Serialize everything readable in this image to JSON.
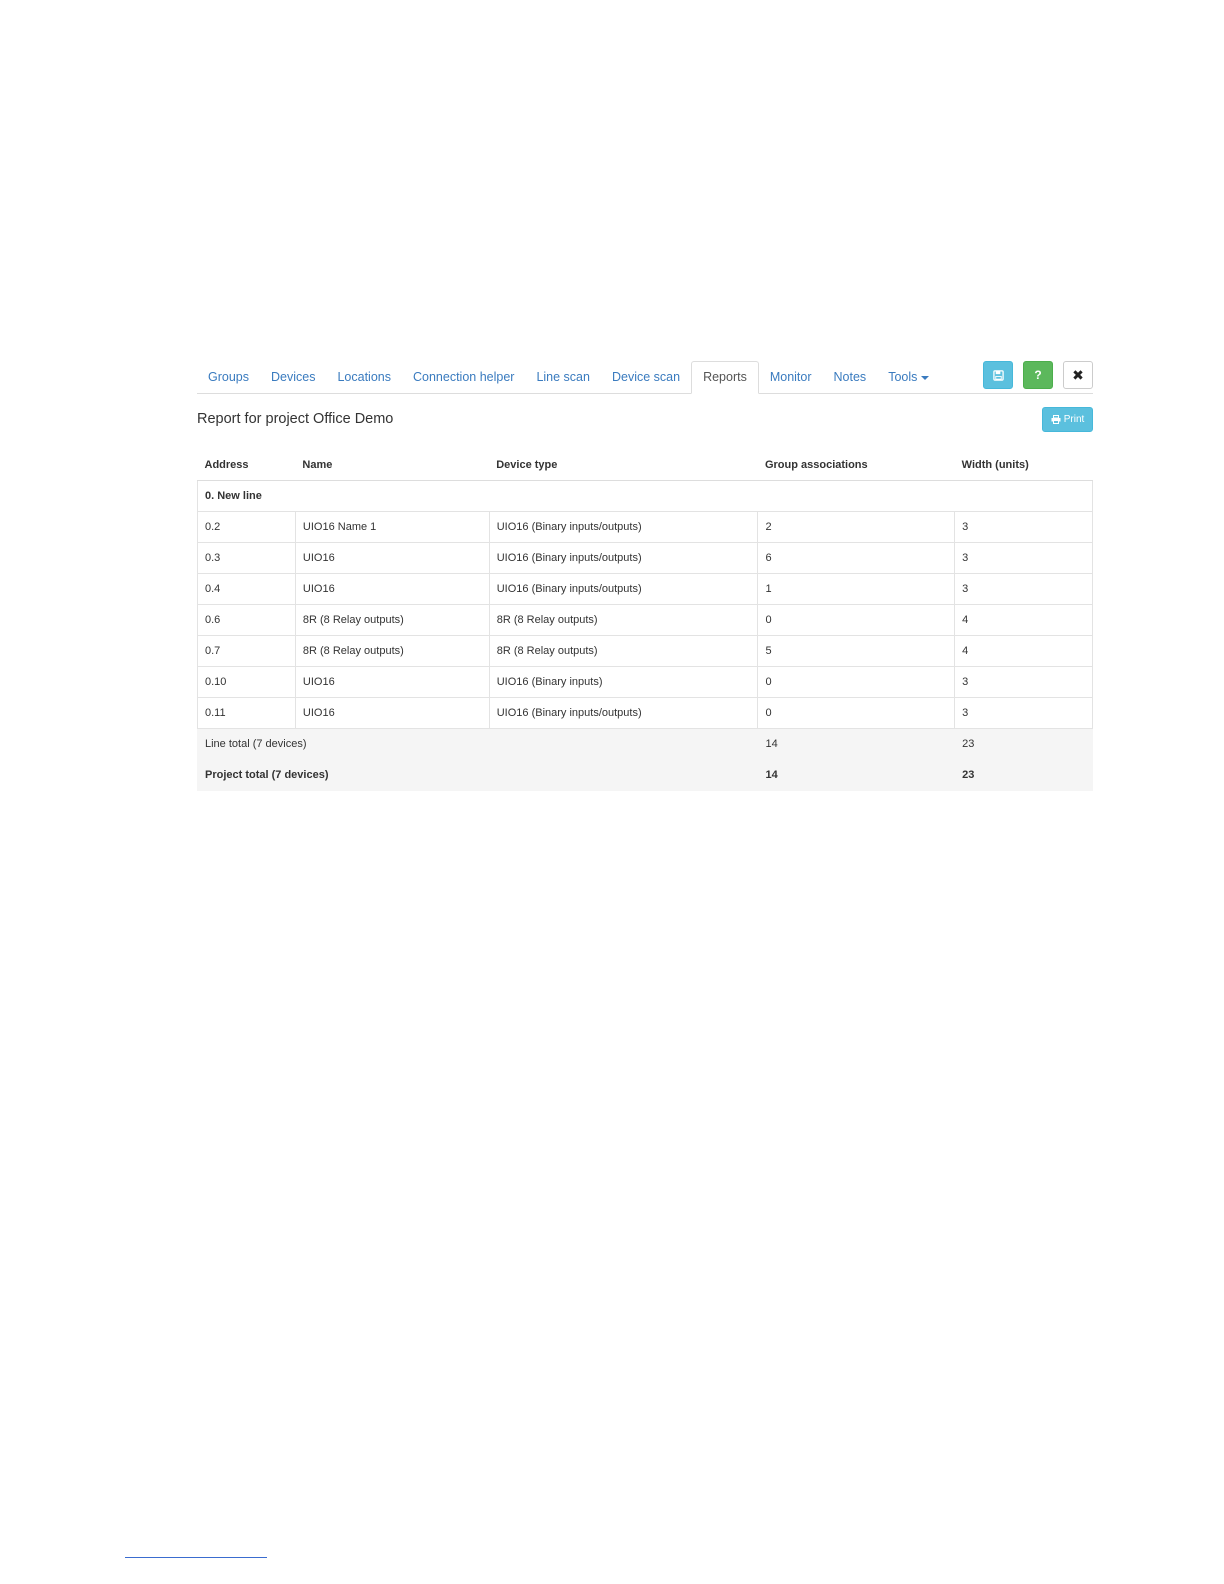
{
  "nav": {
    "tabs": [
      {
        "label": "Groups"
      },
      {
        "label": "Devices"
      },
      {
        "label": "Locations"
      },
      {
        "label": "Connection helper"
      },
      {
        "label": "Line scan"
      },
      {
        "label": "Device scan"
      },
      {
        "label": "Reports",
        "active": true
      },
      {
        "label": "Monitor"
      },
      {
        "label": "Notes"
      },
      {
        "label": "Tools"
      }
    ],
    "actions": {
      "save_icon": "floppy-disk-icon",
      "help_label": "?",
      "close_label": "✖"
    }
  },
  "report": {
    "title": "Report for project Office Demo",
    "print_label": "Print"
  },
  "table": {
    "headers": [
      "Address",
      "Name",
      "Device type",
      "Group associations",
      "Width (units)"
    ],
    "line_name": "0. New line",
    "rows": [
      [
        "0.2",
        "UIO16 Name 1",
        "UIO16 (Binary inputs/outputs)",
        "2",
        "3"
      ],
      [
        "0.3",
        "UIO16",
        "UIO16 (Binary inputs/outputs)",
        "6",
        "3"
      ],
      [
        "0.4",
        "UIO16",
        "UIO16 (Binary inputs/outputs)",
        "1",
        "3"
      ],
      [
        "0.6",
        "8R (8 Relay outputs)",
        "8R (8 Relay outputs)",
        "0",
        "4"
      ],
      [
        "0.7",
        "8R (8 Relay outputs)",
        "8R (8 Relay outputs)",
        "5",
        "4"
      ],
      [
        "0.10",
        "UIO16",
        "UIO16 (Binary inputs)",
        "0",
        "3"
      ],
      [
        "0.11",
        "UIO16",
        "UIO16 (Binary inputs/outputs)",
        "0",
        "3"
      ]
    ],
    "line_total": {
      "label": "Line total (7 devices)",
      "groups": "14",
      "width": "23"
    },
    "project_total": {
      "label": "Project total (7 devices)",
      "groups": "14",
      "width": "23"
    }
  },
  "colors": {
    "link": "#3a7bbf",
    "info": "#5bc0de",
    "success": "#5cb85c"
  }
}
